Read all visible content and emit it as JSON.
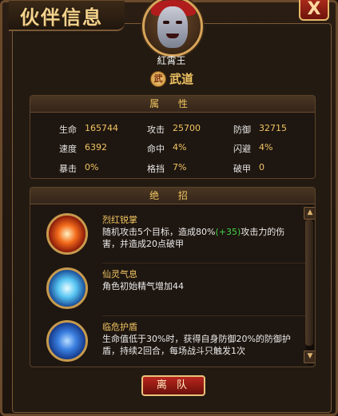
{
  "window": {
    "title": "伙伴信息",
    "close_label": "X"
  },
  "hero": {
    "name": "紅霄王",
    "class_icon": "武",
    "class_label": "武道"
  },
  "attributes": {
    "header": "属 性",
    "items": [
      {
        "label": "生命",
        "value": "165744"
      },
      {
        "label": "攻击",
        "value": "25700"
      },
      {
        "label": "防御",
        "value": "32715"
      },
      {
        "label": "速度",
        "value": "6392"
      },
      {
        "label": "命中",
        "value": "4%"
      },
      {
        "label": "闪避",
        "value": "4%"
      },
      {
        "label": "暴击",
        "value": "0%"
      },
      {
        "label": "格挡",
        "value": "7%"
      },
      {
        "label": "破甲",
        "value": "0"
      }
    ]
  },
  "skills": {
    "header": "绝 招",
    "items": [
      {
        "name": "烈红锐掌",
        "desc_pre": "随机攻击5个目标，造成80%",
        "desc_hl": "(+35)",
        "desc_post": "攻击力的伤害，并造成20点破甲",
        "icon": "flame-burst-icon"
      },
      {
        "name": "仙灵气息",
        "desc_pre": "角色初始精气增加44",
        "desc_hl": "",
        "desc_post": "",
        "icon": "spirit-aura-icon"
      },
      {
        "name": "临危护盾",
        "desc_pre": "生命值低于30%时，获得自身防御20%的防御护盾，持续2回合，每场战斗只触发1次",
        "desc_hl": "",
        "desc_post": "",
        "icon": "shield-guard-icon"
      }
    ]
  },
  "actions": {
    "leave_label": "离 队"
  },
  "colors": {
    "accent_gold": "#f0c462",
    "highlight_green": "#42d24a",
    "button_red": "#b8261e"
  }
}
